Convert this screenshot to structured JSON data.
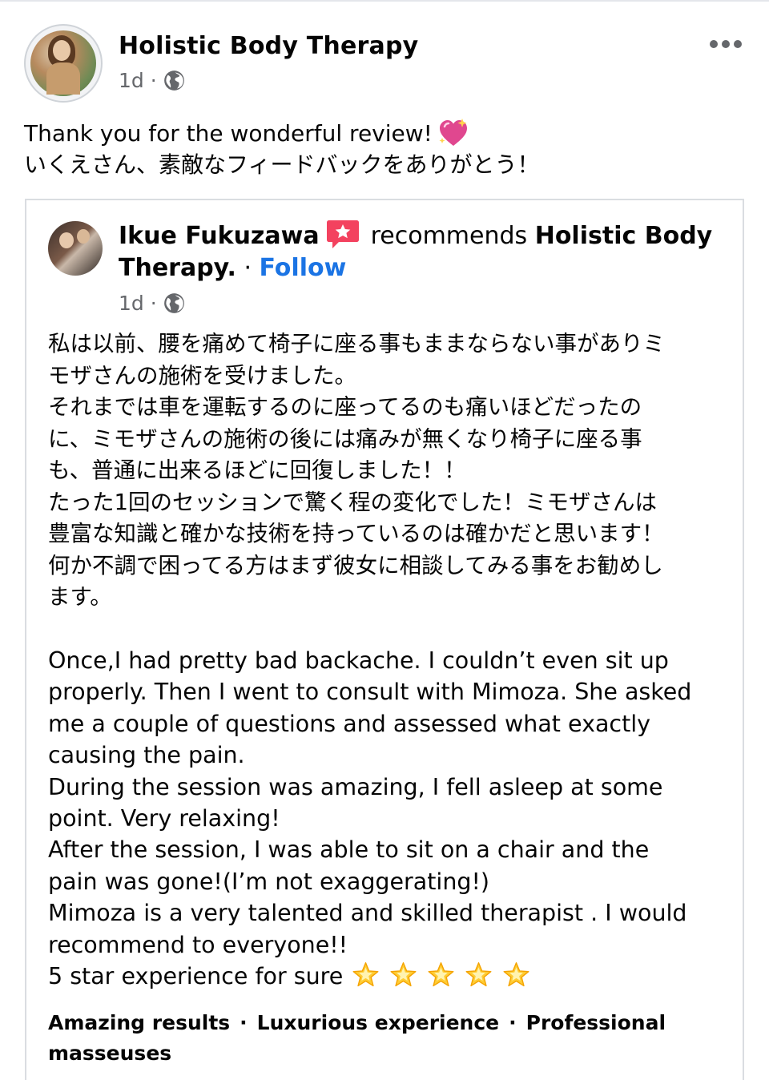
{
  "post": {
    "author_name": "Holistic Body Therapy",
    "time": "1d",
    "separator": "·",
    "audience_icon": "globe-icon",
    "more_icon": "more-options-icon",
    "caption_en": "Thank you for the wonderful review!",
    "caption_emoji": "sparkling-heart-emoji",
    "caption_jp": "いくえさん、素敵なフィードバックをありがとう！"
  },
  "review": {
    "reviewer_name": "Ikue Fukuzawa",
    "badge_icon": "recommendation-badge-icon",
    "recommends_text": "recommends",
    "page_name_part1": "Holistic Body",
    "page_name_part2": "Therapy.",
    "dot": "·",
    "follow_label": "Follow",
    "time": "1d",
    "separator": "·",
    "lines_jp": [
      "私は以前、腰を痛めて椅子に座る事もままならない事がありミ",
      "モザさんの施術を受けました。",
      "それまでは車を運転するのに座ってるのも痛いほどだったの",
      "に、ミモザさんの施術の後には痛みが無くなり椅子に座る事",
      "も、普通に出来るほどに回復しました！！",
      "たった1回のセッションで驚く程の変化でした！ミモザさんは",
      "豊富な知識と確かな技術を持っているのは確かだと思います！",
      "何か不調で困ってる方はまず彼女に相談してみる事をお勧めし",
      "ます。"
    ],
    "lines_en": [
      "Once,I had pretty bad backache. I couldn’t even sit up",
      "properly. Then I went to consult with Mimoza. She asked",
      "me a couple of questions and assessed what exactly",
      "causing the pain.",
      "During the session was amazing, I fell asleep at some",
      "point. Very relaxing!",
      "After the session, I was able to sit on a chair and the",
      "pain was gone!(I’m not exaggerating!)",
      "Mimoza is a very talented  and skilled therapist . I would",
      "recommend to everyone!!"
    ],
    "last_line": "5 star experience for sure",
    "star_count": 5,
    "tags": [
      "Amazing results",
      "Luxurious experience",
      "Professional masseuses"
    ],
    "tag_separator": "·"
  }
}
